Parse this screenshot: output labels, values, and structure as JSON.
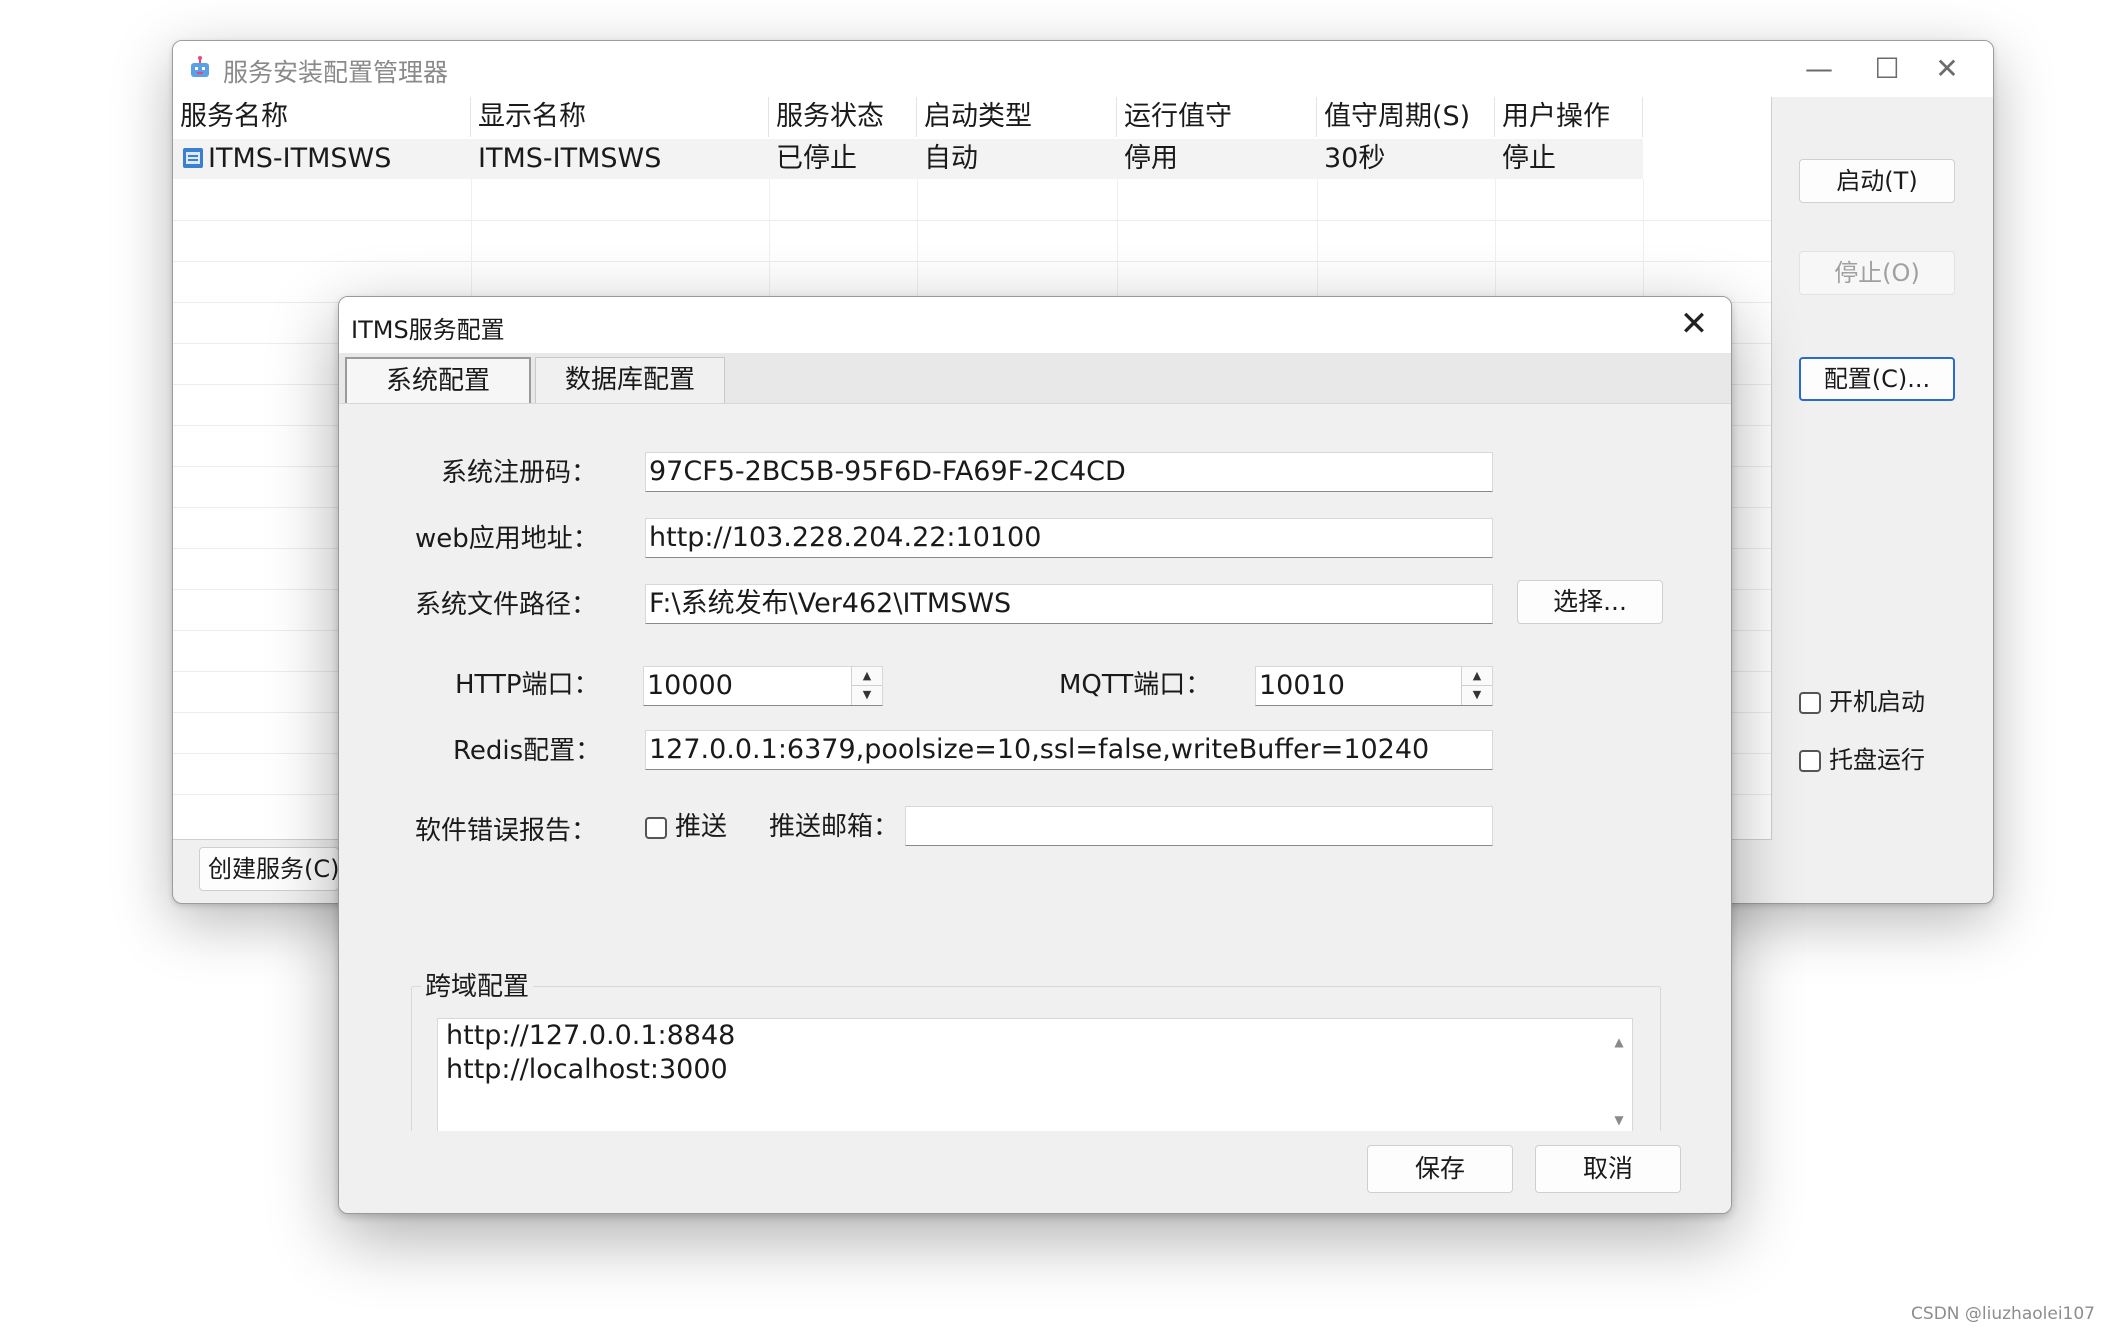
{
  "main_window": {
    "title": "服务安装配置管理器",
    "columns": [
      "服务名称",
      "显示名称",
      "服务状态",
      "启动类型",
      "运行值守",
      "值守周期(S)",
      "用户操作"
    ],
    "rows": [
      [
        "ITMS-ITMSWS",
        "ITMS-ITMSWS",
        "已停止",
        "自动",
        "停用",
        "30秒",
        "停止"
      ]
    ],
    "buttons": {
      "start": "启动(T)",
      "stop": "停止(O)",
      "configure": "配置(C)...",
      "create_service": "创建服务(C)"
    },
    "checkboxes": {
      "auto_start": {
        "label": "开机启动",
        "checked": false
      },
      "tray_run": {
        "label": "托盘运行",
        "checked": false
      }
    },
    "window_controls": {
      "minimize": "—",
      "maximize": "☐",
      "close": "✕"
    }
  },
  "dialog": {
    "title": "ITMS服务配置",
    "close": "✕",
    "tabs": [
      {
        "label": "系统配置",
        "active": true
      },
      {
        "label": "数据库配置",
        "active": false
      }
    ],
    "fields": {
      "reg_code": {
        "label": "系统注册码：",
        "value": "97CF5-2BC5B-95F6D-FA69F-2C4CD"
      },
      "web_address": {
        "label": "web应用地址：",
        "value": "http://103.228.204.22:10100"
      },
      "file_path": {
        "label": "系统文件路径：",
        "value": "F:\\系统发布\\Ver462\\ITMSWS",
        "button": "选择..."
      },
      "http_port": {
        "label": "HTTP端口：",
        "value": "10000"
      },
      "mqtt_port": {
        "label": "MQTT端口：",
        "value": "10010"
      },
      "redis": {
        "label": "Redis配置：",
        "value": "127.0.0.1:6379,poolsize=10,ssl=false,writeBuffer=10240"
      },
      "error_report": {
        "label": "软件错误报告：",
        "push_label": "推送",
        "push_checked": false,
        "email_label": "推送邮箱：",
        "email_value": ""
      }
    },
    "cors": {
      "title": "跨域配置",
      "lines": [
        "http://127.0.0.1:8848",
        "http://localhost:3000"
      ]
    },
    "buttons": {
      "save": "保存",
      "cancel": "取消"
    }
  },
  "watermark": "CSDN @liuzhaolei107",
  "colors": {
    "focus_border": "#2a6bd1",
    "window_bg": "#f0f0f0",
    "row_highlight": "#f3f3f3"
  }
}
